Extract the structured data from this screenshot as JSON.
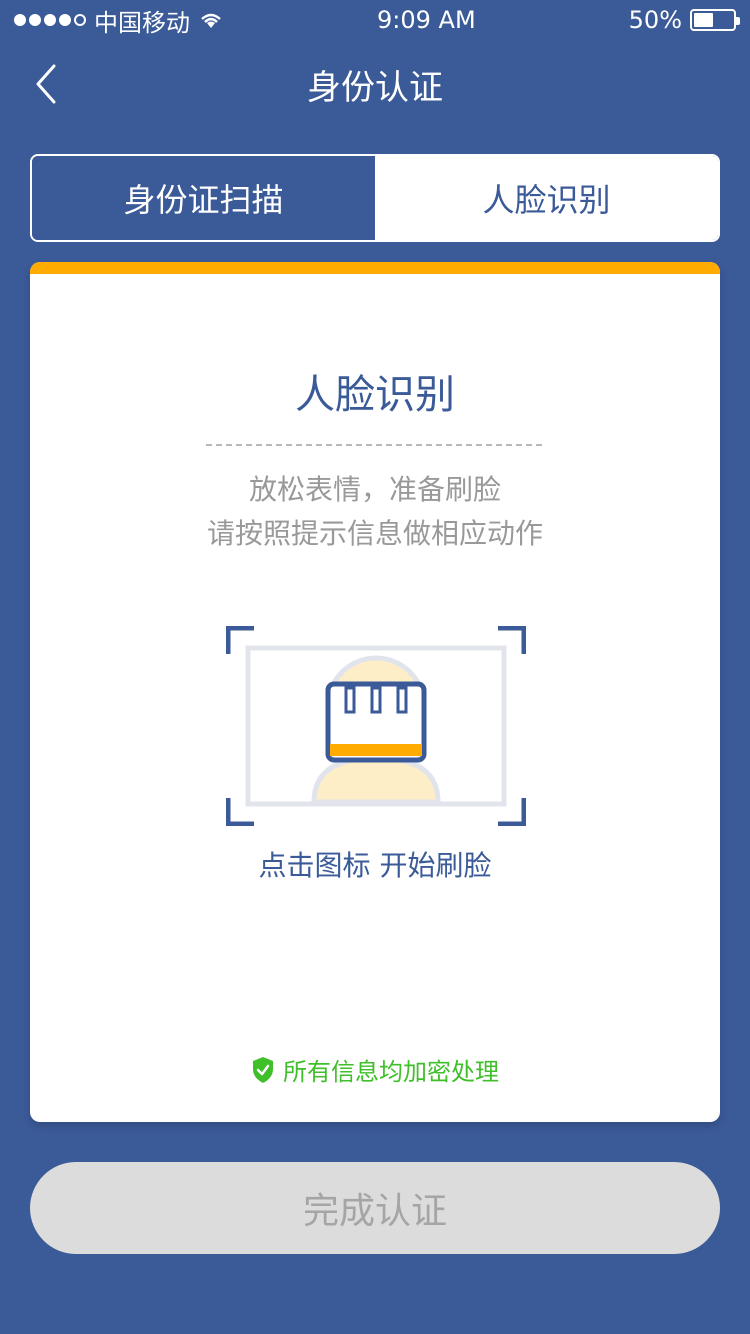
{
  "status_bar": {
    "carrier": "中国移动",
    "time": "9:09 AM",
    "battery": "50%"
  },
  "nav": {
    "title": "身份认证"
  },
  "tabs": [
    {
      "label": "身份证扫描",
      "active": true
    },
    {
      "label": "人脸识别",
      "active": false
    }
  ],
  "card": {
    "title": "人脸识别",
    "hint_line1": "放松表情，准备刷脸",
    "hint_line2": "请按照提示信息做相应动作",
    "start_label": "点击图标 开始刷脸",
    "secure_text": "所有信息均加密处理"
  },
  "complete_button": {
    "label": "完成认证",
    "enabled": false
  },
  "colors": {
    "primary": "#3b5a98",
    "accent": "#ffab00",
    "secure": "#3fbf2a",
    "disabled_bg": "#dcdcdc",
    "disabled_text": "#a5a5a5"
  }
}
